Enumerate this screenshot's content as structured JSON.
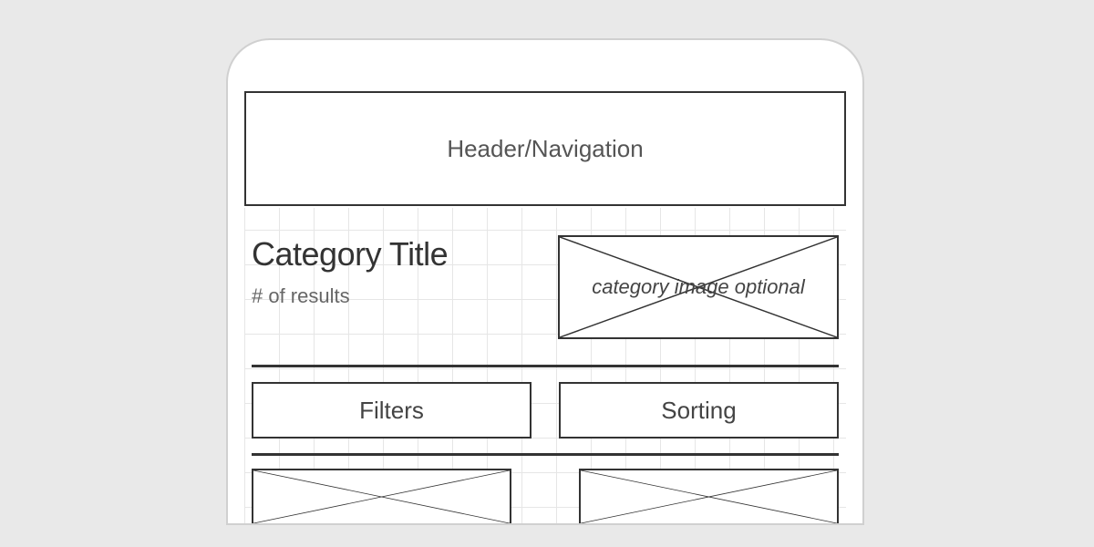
{
  "header": {
    "label": "Header/Navigation"
  },
  "category": {
    "title": "Category Title",
    "results_label": "# of results",
    "image_label": "category image optional"
  },
  "controls": {
    "filters_label": "Filters",
    "sorting_label": "Sorting"
  }
}
